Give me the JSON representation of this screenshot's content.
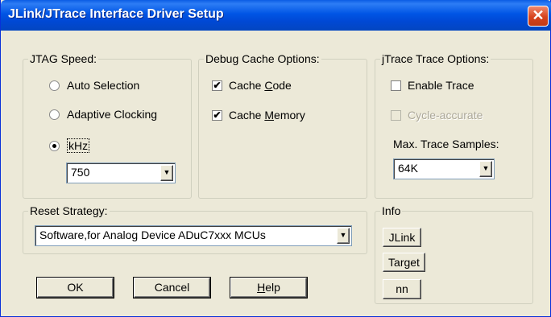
{
  "window": {
    "title": "JLink/JTrace Interface Driver Setup",
    "close_glyph": "✕"
  },
  "jtag": {
    "legend": "JTAG Speed:",
    "auto": "Auto Selection",
    "adaptive": "Adaptive Clocking",
    "khz": "kHz",
    "selected": "khz",
    "speed_value": "750"
  },
  "cache": {
    "legend": "Debug Cache Options:",
    "code_pre": "Cache ",
    "code_u": "C",
    "code_post": "ode",
    "memory_pre": "Cache ",
    "memory_u": "M",
    "memory_post": "emory",
    "code_checked": true,
    "memory_checked": true
  },
  "trace": {
    "legend": "jTrace Trace Options:",
    "enable": "Enable Trace",
    "cycle": "Cycle-accurate",
    "samples_label": "Max. Trace Samples:",
    "samples_value": "64K",
    "enable_checked": false,
    "cycle_checked": false
  },
  "reset": {
    "legend": "Reset Strategy:",
    "value": "Software,for Analog Device ADuC7xxx MCUs"
  },
  "info": {
    "legend": "Info",
    "jlink": "JLink",
    "target": "Target",
    "nn": "nn"
  },
  "buttons": {
    "ok": "OK",
    "cancel": "Cancel",
    "help_u": "H",
    "help_post": "elp"
  },
  "icons": {
    "dropdown": "▼",
    "check": "✔"
  },
  "colors": {
    "titlebar": "#0055E5",
    "face": "#ECE9D8",
    "close": "#D7431D"
  }
}
